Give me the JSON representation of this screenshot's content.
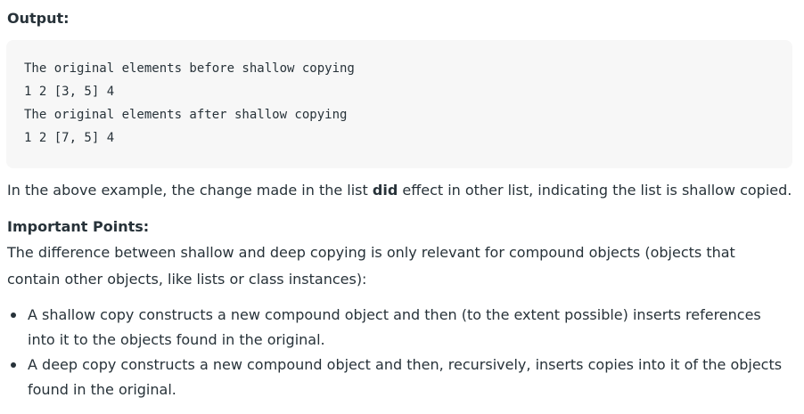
{
  "output_heading": "Output:",
  "code_lines": [
    "The original elements before shallow copying",
    "1 2 [3, 5] 4",
    "The original elements after shallow copying",
    "1 2 [7, 5] 4"
  ],
  "example_paragraph": {
    "before": "In the above example, the change made in the list ",
    "bold": "did",
    "after": " effect in other list, indicating the list is shallow copied."
  },
  "important_heading": "Important Points:",
  "difference_paragraph": {
    "line1": "The difference between shallow and deep copying is only relevant for compound objects (objects that",
    "line2": "contain other objects, like lists or class instances):"
  },
  "bullets": [
    {
      "line1": "A shallow copy constructs a new compound object and then (to the extent possible) inserts references",
      "line2": "into it to the objects found in the original."
    },
    {
      "line1": "A deep copy constructs a new compound object and then, recursively, inserts copies into it of the objects",
      "line2": "found in the original."
    }
  ]
}
